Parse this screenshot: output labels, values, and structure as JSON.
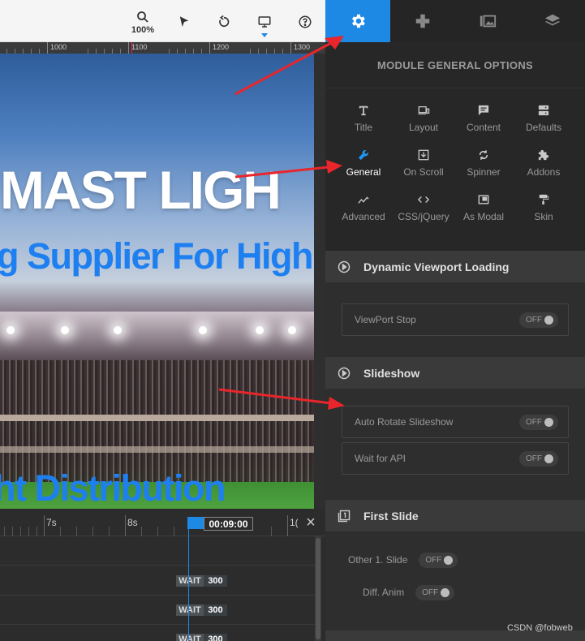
{
  "toolbar": {
    "zoom_label": "100%"
  },
  "ruler": {
    "labels": [
      "1000",
      "1100",
      "1200",
      "1300"
    ]
  },
  "canvas": {
    "headline": "MAST LIGH",
    "subheadline": "g Supplier For High",
    "bottom_line": "ht Distribution"
  },
  "timeline": {
    "labels": [
      "7s",
      "8s",
      "1("
    ],
    "current_time": "00:09:00",
    "close_icon": "×",
    "rows": [
      {
        "wait_label": "WAIT",
        "wait_value": "300"
      },
      {
        "wait_label": "WAIT",
        "wait_value": "300"
      },
      {
        "wait_label": "WAIT",
        "wait_value": "300"
      }
    ]
  },
  "panel": {
    "title": "MODULE GENERAL OPTIONS",
    "options": [
      {
        "label": "Title",
        "icon": "title-icon"
      },
      {
        "label": "Layout",
        "icon": "layout-icon"
      },
      {
        "label": "Content",
        "icon": "content-icon"
      },
      {
        "label": "Defaults",
        "icon": "defaults-icon"
      },
      {
        "label": "General",
        "icon": "wrench-icon"
      },
      {
        "label": "On Scroll",
        "icon": "on-scroll-icon"
      },
      {
        "label": "Spinner",
        "icon": "spinner-icon"
      },
      {
        "label": "Addons",
        "icon": "puzzle-icon"
      },
      {
        "label": "Advanced",
        "icon": "advanced-icon"
      },
      {
        "label": "CSS/jQuery",
        "icon": "code-icon"
      },
      {
        "label": "As Modal",
        "icon": "modal-icon"
      },
      {
        "label": "Skin",
        "icon": "paint-roller-icon"
      }
    ],
    "sections": {
      "viewport": {
        "title": "Dynamic Viewport Loading",
        "rows": [
          {
            "label": "ViewPort Stop",
            "toggle": "OFF"
          }
        ]
      },
      "slideshow": {
        "title": "Slideshow",
        "rows": [
          {
            "label": "Auto Rotate Slideshow",
            "toggle": "OFF"
          },
          {
            "label": "Wait for API",
            "toggle": "OFF"
          }
        ]
      },
      "first_slide": {
        "title": "First Slide",
        "rows": [
          {
            "label": "Other 1. Slide",
            "toggle": "OFF"
          },
          {
            "label": "Diff. Anim",
            "toggle": "OFF"
          }
        ]
      }
    }
  },
  "watermark": "CSDN @fobweb",
  "colors": {
    "accent": "#1e88e5",
    "annotation_arrow": "#e8262b"
  }
}
